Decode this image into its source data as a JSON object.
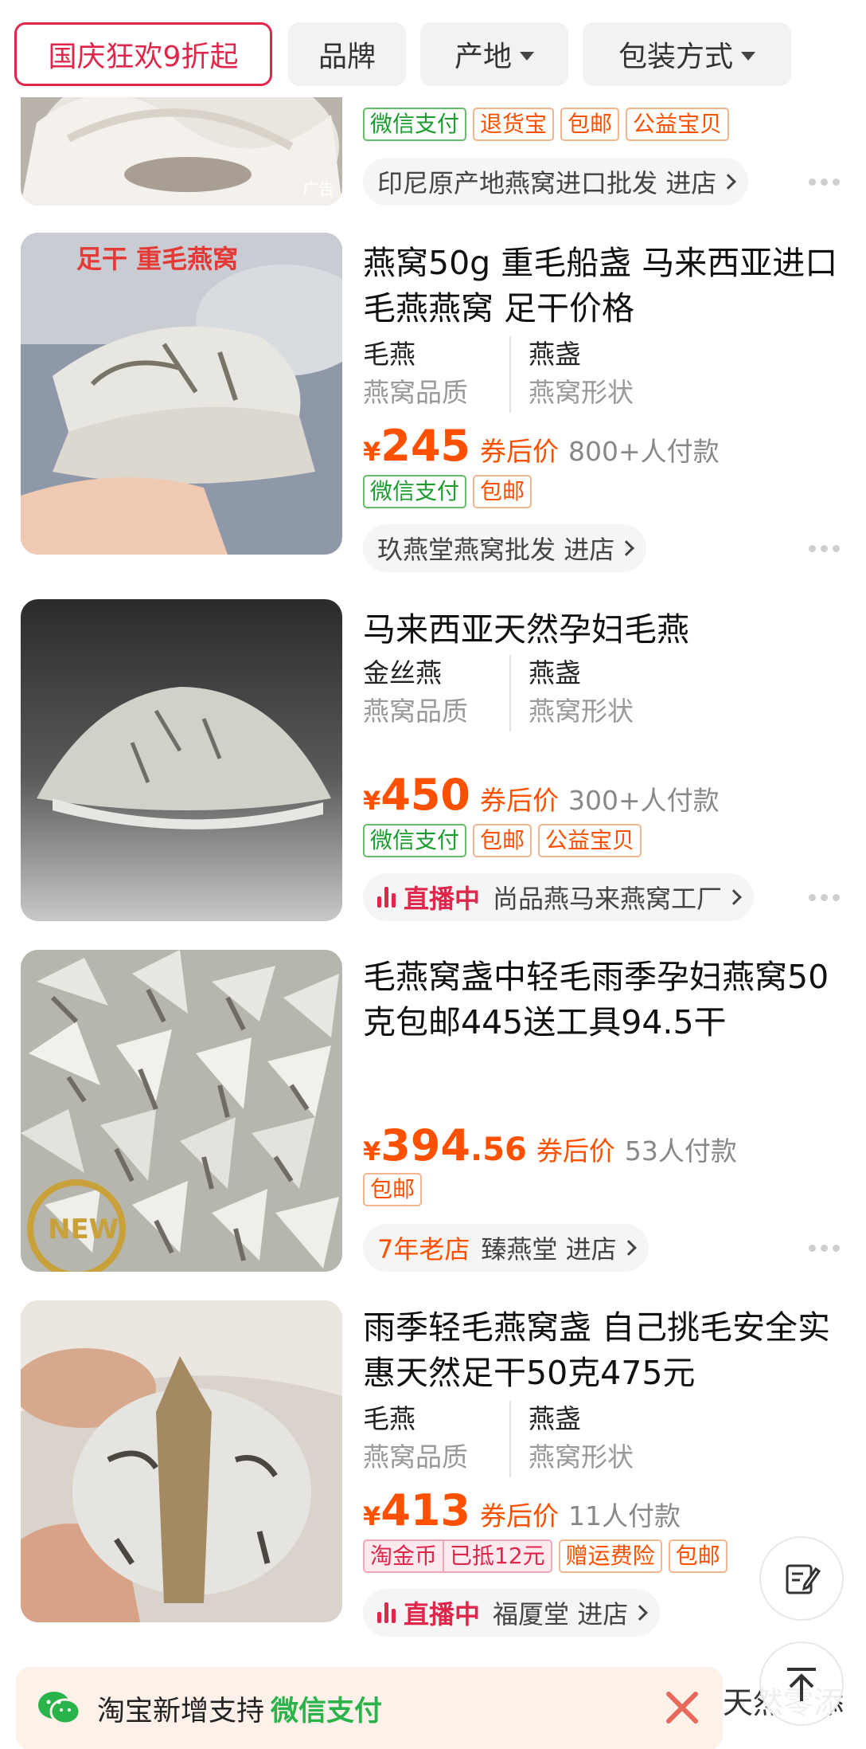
{
  "filters": {
    "promo": "国庆狂欢9折起",
    "brand": "品牌",
    "origin": "产地",
    "packaging": "包装方式"
  },
  "products": [
    {
      "title": "",
      "tags": [
        "微信支付",
        "退货宝",
        "包邮",
        "公益宝贝"
      ],
      "store": {
        "name": "印尼原产地燕窝进口批发",
        "action": "进店"
      },
      "ad_label": "广告"
    },
    {
      "title": "燕窝50g 重毛船盏 马来西亚进口毛燕燕窝 足干价格",
      "image_caption": "足干 重毛燕窝",
      "attrs": [
        {
          "value": "毛燕",
          "key": "燕窝品质"
        },
        {
          "value": "燕盏",
          "key": "燕窝形状"
        }
      ],
      "currency": "¥",
      "price": "245",
      "price_note": "券后价",
      "paid": "800+人付款",
      "tags": [
        "微信支付",
        "包邮"
      ],
      "store": {
        "name": "玖燕堂燕窝批发",
        "action": "进店"
      }
    },
    {
      "title": "马来西亚天然孕妇毛燕",
      "attrs": [
        {
          "value": "金丝燕",
          "key": "燕窝品质"
        },
        {
          "value": "燕盏",
          "key": "燕窝形状"
        }
      ],
      "currency": "¥",
      "price": "450",
      "price_note": "券后价",
      "paid": "300+人付款",
      "tags": [
        "微信支付",
        "包邮",
        "公益宝贝"
      ],
      "store": {
        "live": "直播中",
        "name": "尚品燕马来燕窝工厂"
      }
    },
    {
      "title": "毛燕窝盏中轻毛雨季孕妇燕窝50克包邮445送工具94.5干",
      "currency": "¥",
      "price": "394",
      "price_decimal": ".56",
      "price_note": "券后价",
      "paid": "53人付款",
      "tags": [
        "包邮"
      ],
      "store": {
        "badge": "7年老店",
        "name": "臻燕堂",
        "action": "进店"
      },
      "image_stamp": "NEW"
    },
    {
      "title": "雨季轻毛燕窝盏 自己挑毛安全实惠天然足干50克475元",
      "attrs": [
        {
          "value": "毛燕",
          "key": "燕窝品质"
        },
        {
          "value": "燕盏",
          "key": "燕窝形状"
        }
      ],
      "currency": "¥",
      "price": "413",
      "price_note": "券后价",
      "paid": "11人付款",
      "tags": [
        "淘金币",
        "已抵12元",
        "赠运费险",
        "包邮"
      ],
      "store": {
        "live": "直播中",
        "name": "福厦堂",
        "action": "进店"
      }
    }
  ],
  "banner": {
    "text": "淘宝新增支持",
    "highlight": "微信支付"
  },
  "partial_text": "天然零添",
  "icons": [
    "caret-down-icon",
    "chevron-right-icon",
    "more-dots-icon",
    "live-bars-icon",
    "edit-note-icon",
    "back-to-top-icon",
    "wechat-icon",
    "close-icon"
  ],
  "colors": {
    "price": "#ff5000",
    "promo": "#e0264a",
    "wechat": "#2bb34b"
  }
}
